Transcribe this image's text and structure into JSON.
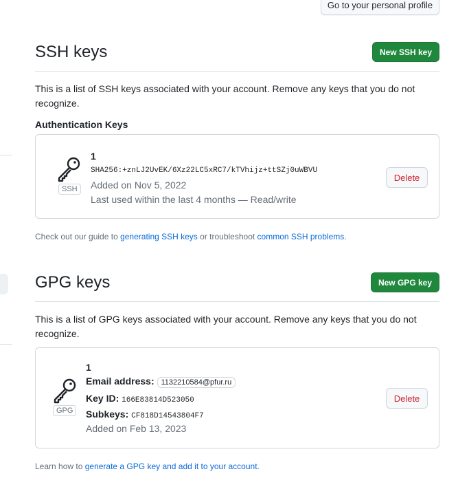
{
  "header": {
    "profile_button": "Go to your personal profile"
  },
  "ssh": {
    "title": "SSH keys",
    "new_button": "New SSH key",
    "description": "This is a list of SSH keys associated with your account. Remove any keys that you do not recognize.",
    "subheading": "Authentication Keys",
    "key": {
      "name": "1",
      "badge": "SSH",
      "fingerprint": "SHA256:+znLJ2UvEK/6Xz22LC5xRC7/kTVhijz+ttSZj0uWBVU",
      "added": "Added on Nov 5, 2022",
      "last_used": "Last used within the last 4 months — Read/write",
      "delete_label": "Delete"
    },
    "footer": {
      "prefix": "Check out our guide to ",
      "link1": "generating SSH keys",
      "middle": " or troubleshoot ",
      "link2": "common SSH problems",
      "suffix": "."
    }
  },
  "gpg": {
    "title": "GPG keys",
    "new_button": "New GPG key",
    "description": "This is a list of GPG keys associated with your account. Remove any keys that you do not recognize.",
    "key": {
      "name": "1",
      "badge": "GPG",
      "email_label": "Email address:",
      "email": "1132210584@pfur.ru",
      "key_id_label": "Key ID:",
      "key_id": "166E83814D523050",
      "subkeys_label": "Subkeys:",
      "subkeys": "CF818D14543804F7",
      "added": "Added on Feb 13, 2023",
      "delete_label": "Delete"
    },
    "footer": {
      "prefix": "Learn how to ",
      "link": "generate a GPG key and add it to your account",
      "suffix": "."
    }
  },
  "colors": {
    "primary_button": "#1f883d",
    "danger_text": "#cf222e",
    "link": "#0969da",
    "muted_text": "#656d76",
    "border": "#d0d7de"
  },
  "icons": [
    "key-icon"
  ]
}
